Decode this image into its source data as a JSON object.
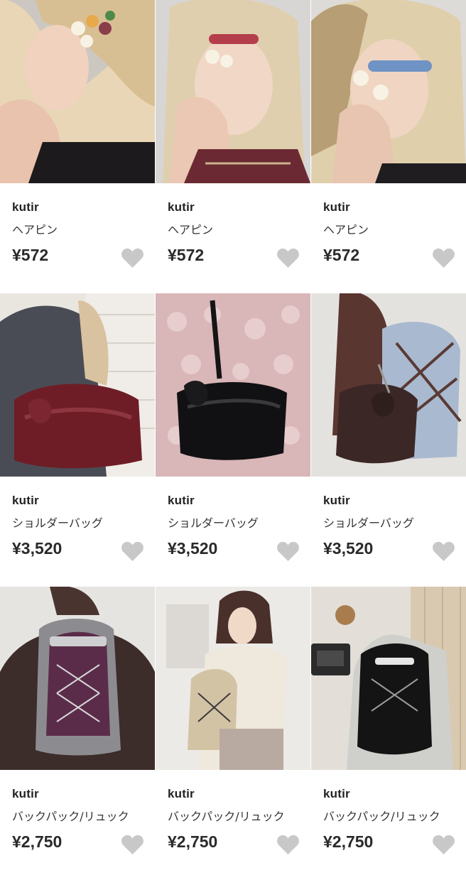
{
  "products": [
    {
      "brand": "kutir",
      "name": "ヘアピン",
      "price": "¥572",
      "image": "hairpin-multicolor-photo",
      "favorite_icon": "heart-icon"
    },
    {
      "brand": "kutir",
      "name": "ヘアピン",
      "price": "¥572",
      "image": "hairpin-red-check-photo",
      "favorite_icon": "heart-icon"
    },
    {
      "brand": "kutir",
      "name": "ヘアピン",
      "price": "¥572",
      "image": "hairpin-blue-photo",
      "favorite_icon": "heart-icon"
    },
    {
      "brand": "kutir",
      "name": "ショルダーバッグ",
      "price": "¥3,520",
      "image": "shoulder-bag-burgundy-photo",
      "favorite_icon": "heart-icon"
    },
    {
      "brand": "kutir",
      "name": "ショルダーバッグ",
      "price": "¥3,520",
      "image": "shoulder-bag-black-photo",
      "favorite_icon": "heart-icon"
    },
    {
      "brand": "kutir",
      "name": "ショルダーバッグ",
      "price": "¥3,520",
      "image": "shoulder-bag-brown-photo",
      "favorite_icon": "heart-icon"
    },
    {
      "brand": "kutir",
      "name": "バックパック/リュック",
      "price": "¥2,750",
      "image": "backpack-purple-photo",
      "favorite_icon": "heart-icon"
    },
    {
      "brand": "kutir",
      "name": "バックパック/リュック",
      "price": "¥2,750",
      "image": "backpack-beige-photo",
      "favorite_icon": "heart-icon"
    },
    {
      "brand": "kutir",
      "name": "バックパック/リュック",
      "price": "¥2,750",
      "image": "backpack-black-photo",
      "favorite_icon": "heart-icon"
    }
  ],
  "colors": {
    "heart": "#c8c8c8",
    "text_primary": "#222222",
    "background": "#ffffff"
  }
}
